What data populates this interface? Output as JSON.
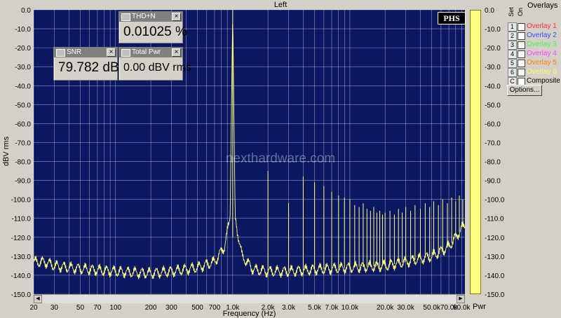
{
  "title": "Left",
  "chart_data": {
    "type": "line",
    "xlabel": "Frequency (Hz)",
    "ylabel": "dBV rms",
    "xscale": "log",
    "xlim": [
      20,
      96000
    ],
    "ylim": [
      -150,
      0
    ],
    "grid": true,
    "x_ticks": [
      20,
      30,
      50,
      70,
      100,
      200,
      300,
      500,
      700,
      1000,
      2000,
      3000,
      5000,
      7000,
      10000,
      20000,
      30000,
      50000,
      70000,
      90000
    ],
    "x_tick_labels": [
      "20",
      "30",
      "50",
      "70",
      "100",
      "200",
      "300",
      "500",
      "700",
      "1.0k",
      "2.0k",
      "3.0k",
      "5.0k",
      "7.0k",
      "10.0k",
      "20.0k",
      "30.0k",
      "50.0k",
      "70.0k",
      "90.0k"
    ],
    "y_ticks": [
      0,
      -10,
      -20,
      -30,
      -40,
      -50,
      -60,
      -70,
      -80,
      -90,
      -100,
      -110,
      -120,
      -130,
      -140,
      -150
    ],
    "y_tick_labels": [
      "0.0",
      "-10.0",
      "-20.0",
      "-30.0",
      "-40.0",
      "-50.0",
      "-60.0",
      "-70.0",
      "-80.0",
      "-90.0",
      "-100.0",
      "-110.0",
      "-120.0",
      "-130.0",
      "-140.0",
      "-150.0"
    ],
    "right_y_tick_labels": [
      "0.0",
      "-10.0",
      "-20.0",
      "-30.0",
      "-40.0",
      "-50.0",
      "-60.0",
      "-70.0",
      "-80.0",
      "-90.0",
      "-100.0",
      "-110.0",
      "-120.0",
      "-130.0",
      "-140.0",
      "-150.0"
    ],
    "noise_floor": [
      [
        20,
        -133
      ],
      [
        25,
        -133
      ],
      [
        30,
        -135
      ],
      [
        40,
        -136
      ],
      [
        60,
        -137
      ],
      [
        100,
        -138
      ],
      [
        200,
        -139
      ],
      [
        300,
        -138
      ],
      [
        500,
        -136
      ],
      [
        700,
        -133
      ],
      [
        850,
        -125
      ],
      [
        950,
        -110
      ],
      [
        1000,
        0
      ],
      [
        1050,
        -110
      ],
      [
        1200,
        -130
      ],
      [
        1500,
        -137
      ],
      [
        2000,
        -138
      ],
      [
        3000,
        -138
      ],
      [
        5000,
        -137
      ],
      [
        10000,
        -136
      ],
      [
        20000,
        -135
      ],
      [
        30000,
        -133
      ],
      [
        50000,
        -130
      ],
      [
        70000,
        -125
      ],
      [
        96000,
        -113
      ]
    ],
    "harmonics": [
      [
        2000,
        -85
      ],
      [
        3000,
        -102
      ],
      [
        4000,
        -88
      ],
      [
        5000,
        -91
      ],
      [
        6000,
        -93
      ],
      [
        7000,
        -96
      ],
      [
        8000,
        -98
      ],
      [
        9000,
        -99
      ],
      [
        10000,
        -100
      ],
      [
        11000,
        -103
      ],
      [
        12000,
        -104
      ],
      [
        13000,
        -102
      ],
      [
        14000,
        -105
      ],
      [
        15000,
        -106
      ],
      [
        16000,
        -104
      ],
      [
        17000,
        -107
      ],
      [
        18000,
        -106
      ],
      [
        19000,
        -108
      ],
      [
        20000,
        -107
      ],
      [
        22000,
        -106
      ],
      [
        24000,
        -108
      ],
      [
        26000,
        -105
      ],
      [
        28000,
        -107
      ],
      [
        30000,
        -104
      ],
      [
        33000,
        -106
      ],
      [
        36000,
        -103
      ],
      [
        40000,
        -105
      ],
      [
        44000,
        -102
      ],
      [
        48000,
        -104
      ],
      [
        52000,
        -101
      ],
      [
        57000,
        -103
      ],
      [
        62000,
        -100
      ],
      [
        68000,
        -102
      ],
      [
        74000,
        -99
      ],
      [
        80000,
        -101
      ],
      [
        86000,
        -98
      ],
      [
        92000,
        -100
      ]
    ],
    "line_color": "#ffff80",
    "background": "#0b1760",
    "grid_color": "#ffffff"
  },
  "meters": {
    "thd": {
      "label": "THD+N",
      "value": "0.01025 %"
    },
    "snr": {
      "label": "SNR",
      "value": "79.782 dB"
    },
    "total_pwr": {
      "label": "Total Pwr",
      "value": "0.00 dBV rms"
    }
  },
  "logo": "PHS",
  "watermark": "nexthardware.com",
  "pwr_label": "Pwr",
  "overlays": {
    "title": "Overlays",
    "set_label": "Set",
    "on_label": "On",
    "items": [
      {
        "num": "1",
        "label": "Overlay 1",
        "color": "#ff3030"
      },
      {
        "num": "2",
        "label": "Overlay 2",
        "color": "#3050ff"
      },
      {
        "num": "3",
        "label": "Overlay 3",
        "color": "#40ff40"
      },
      {
        "num": "4",
        "label": "Overlay 4",
        "color": "#ff40ff"
      },
      {
        "num": "5",
        "label": "Overlay 5",
        "color": "#ff8000"
      },
      {
        "num": "6",
        "label": "Overlay 6",
        "color": "#ffff60"
      },
      {
        "num": "C",
        "label": "Composite",
        "color": "#000000"
      }
    ],
    "options_label": "Options..."
  }
}
